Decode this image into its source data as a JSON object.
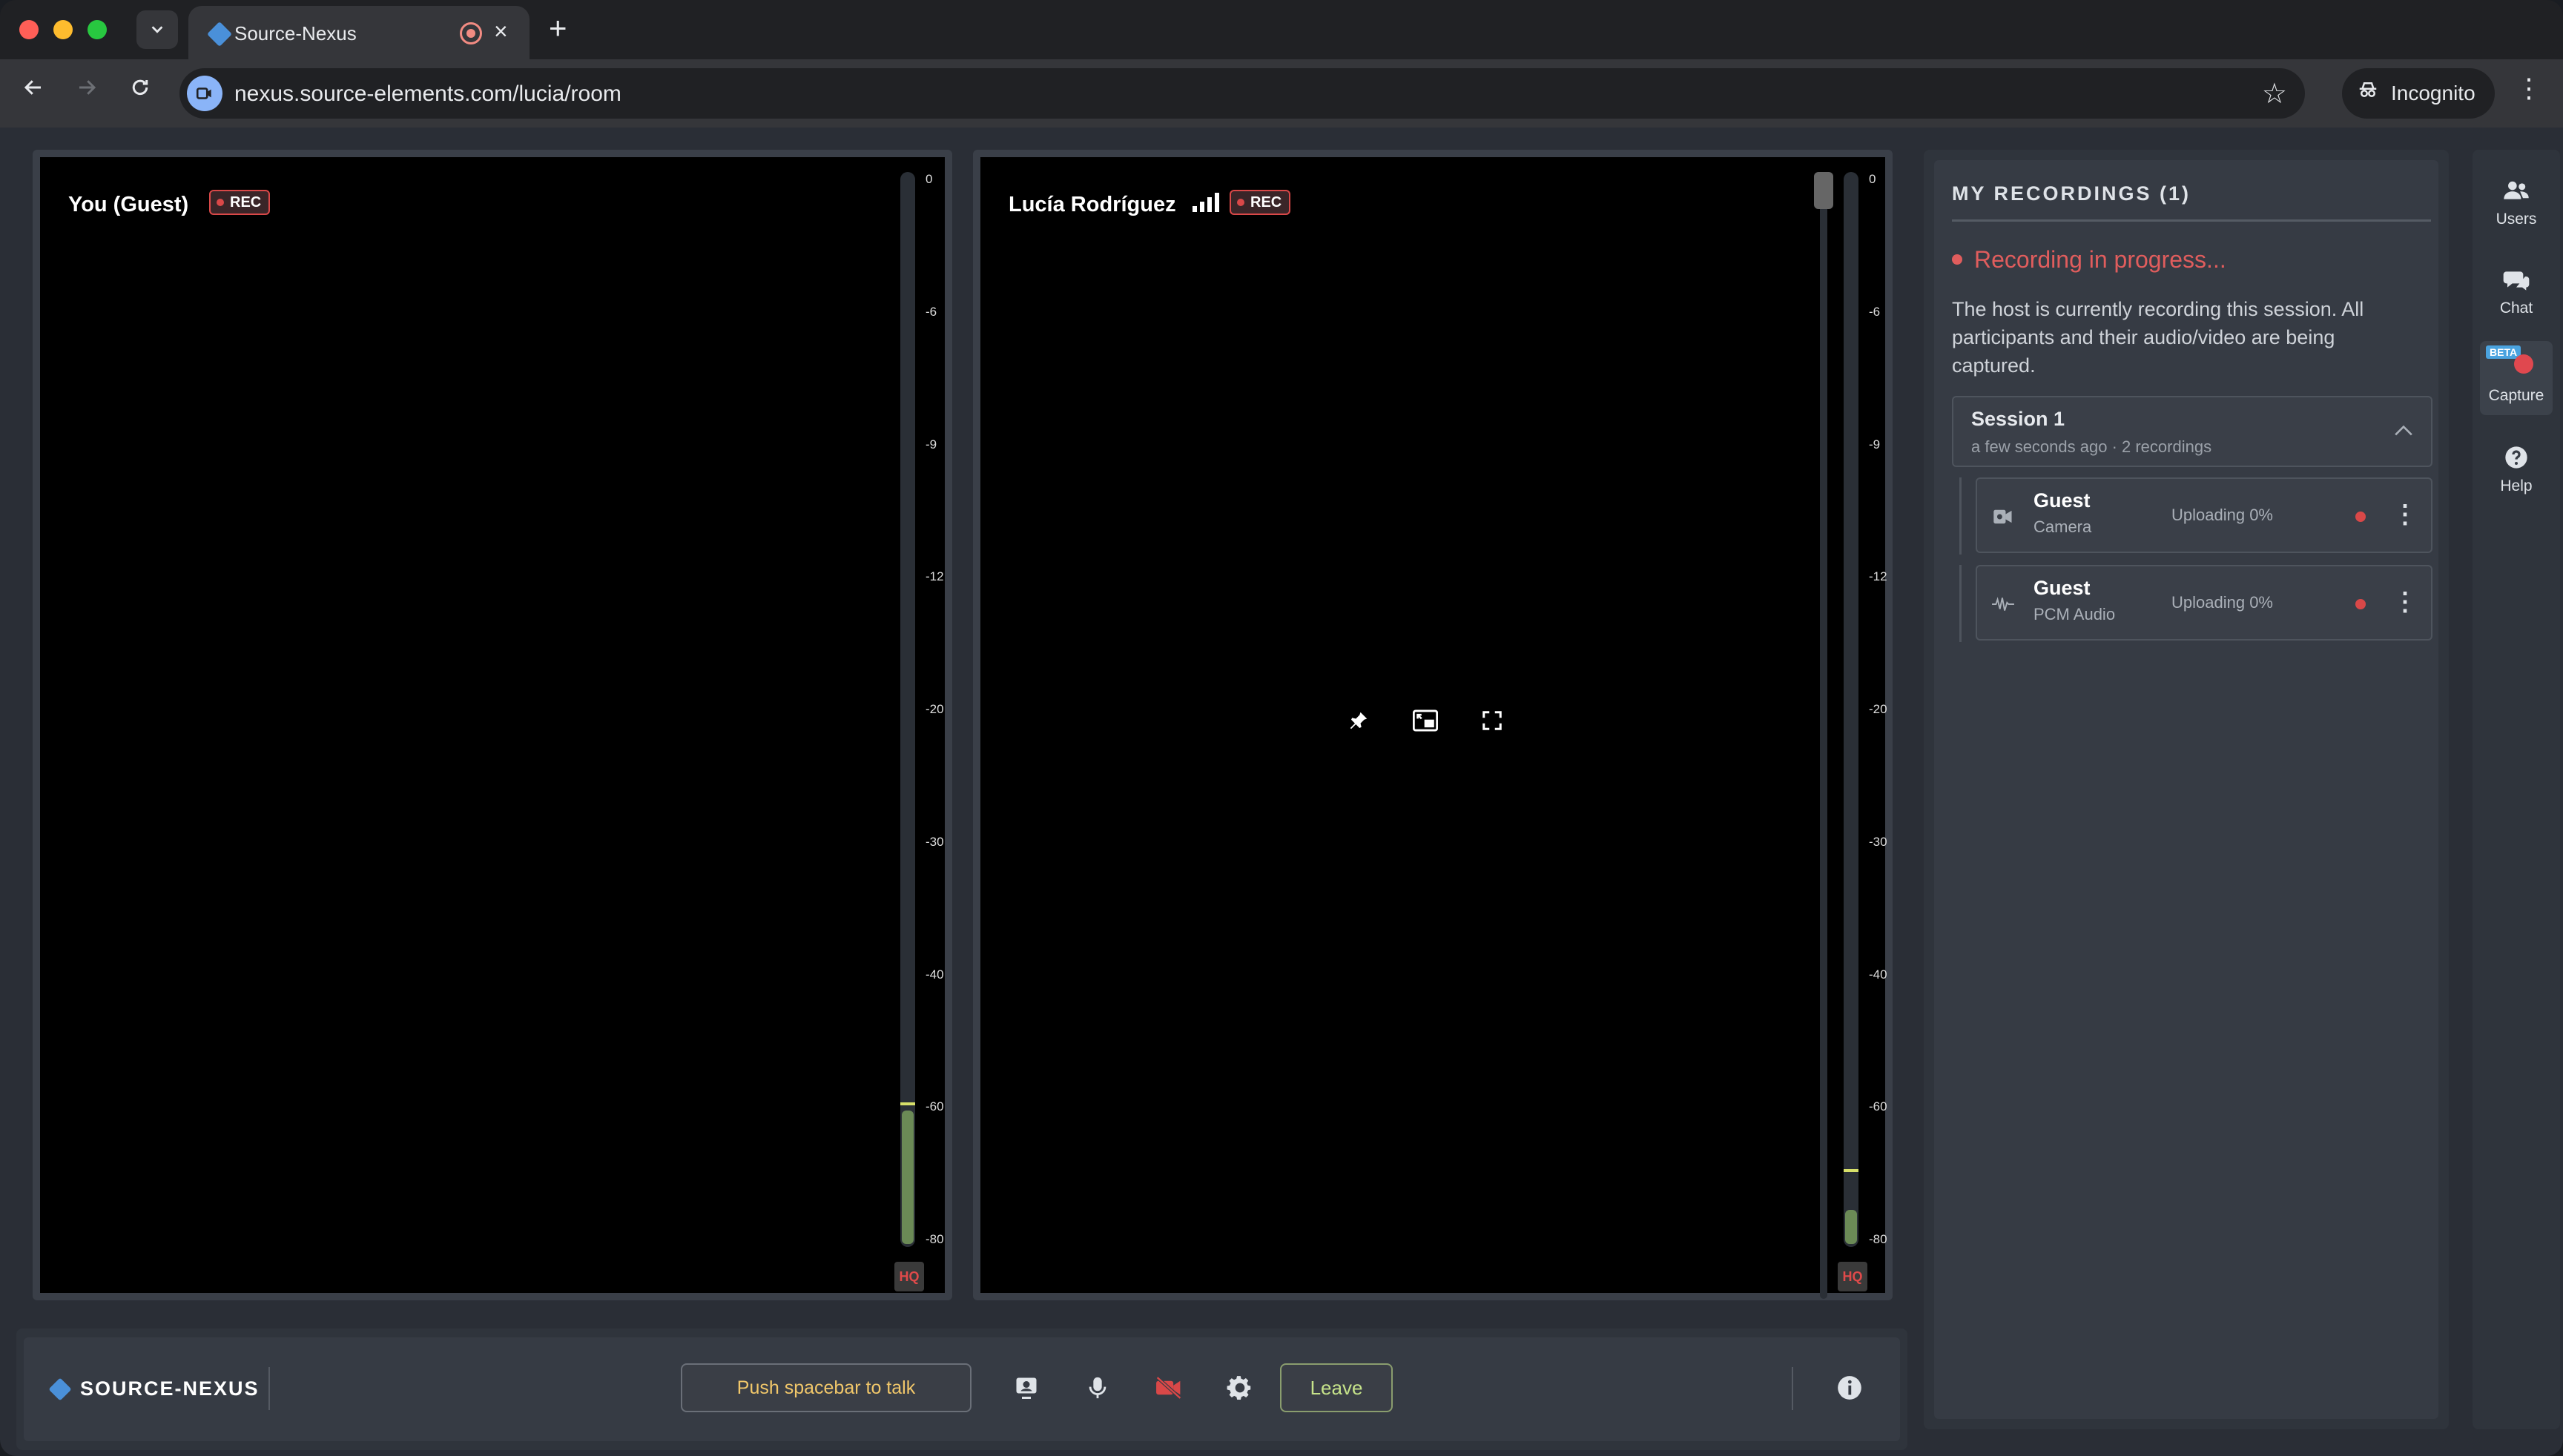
{
  "browser": {
    "tab_title": "Source-Nexus",
    "url": "nexus.source-elements.com/lucia/room",
    "incognito_label": "Incognito"
  },
  "tiles": [
    {
      "name": "You (Guest)",
      "rec_label": "REC",
      "meter_level_db": -61,
      "meter_peak_db": -60,
      "hq_label": "HQ"
    },
    {
      "name": "Lucía Rodríguez",
      "rec_label": "REC",
      "meter_level_db": -76,
      "meter_peak_db": -70,
      "hq_label": "HQ"
    }
  ],
  "meter_ticks": [
    "0",
    "-6",
    "-9",
    "-12",
    "-20",
    "-30",
    "-40",
    "-60",
    "-80"
  ],
  "bottombar": {
    "brand": "SOURCE-NEXUS",
    "ptt_label": "Push spacebar to talk",
    "leave_label": "Leave"
  },
  "recordings": {
    "title": "MY RECORDINGS (1)",
    "status": "Recording in progress...",
    "notice": "The host is currently recording this session. All participants and their audio/video are being captured.",
    "session": {
      "title": "Session 1",
      "subtitle": "a few seconds ago · 2 recordings"
    },
    "items": [
      {
        "name": "Guest",
        "type": "Camera",
        "status": "Uploading 0%",
        "icon": "video-file-icon"
      },
      {
        "name": "Guest",
        "type": "PCM Audio",
        "status": "Uploading 0%",
        "icon": "waveform-icon"
      }
    ]
  },
  "rail": {
    "users": "Users",
    "chat": "Chat",
    "capture": "Capture",
    "capture_badge": "BETA",
    "help": "Help"
  }
}
